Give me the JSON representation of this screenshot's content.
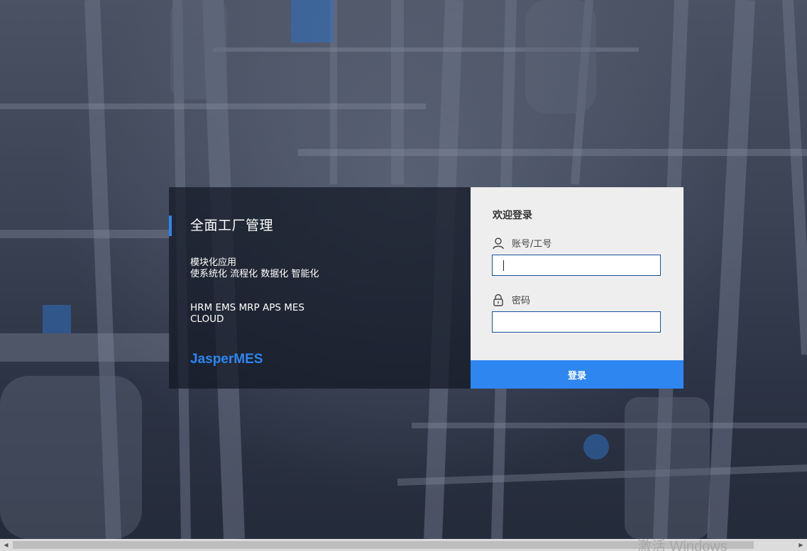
{
  "promo": {
    "title": "全面工厂管理",
    "line1": "模块化应用",
    "line2": "使系统化 流程化 数据化 智能化",
    "modules": "HRM EMS MRP APS MES CLOUD",
    "brand": "JasperMES"
  },
  "login": {
    "welcome": "欢迎登录",
    "account_label": "账号/工号",
    "account_value": "",
    "password_label": "密码",
    "password_value": "",
    "submit_label": "登录",
    "account_icon": "user-icon",
    "password_icon": "lock-icon"
  },
  "watermark": "激活 Windows",
  "colors": {
    "accent": "#2e86f0",
    "input_border": "#1b4f9c",
    "panel_bg": "#efeeee"
  }
}
